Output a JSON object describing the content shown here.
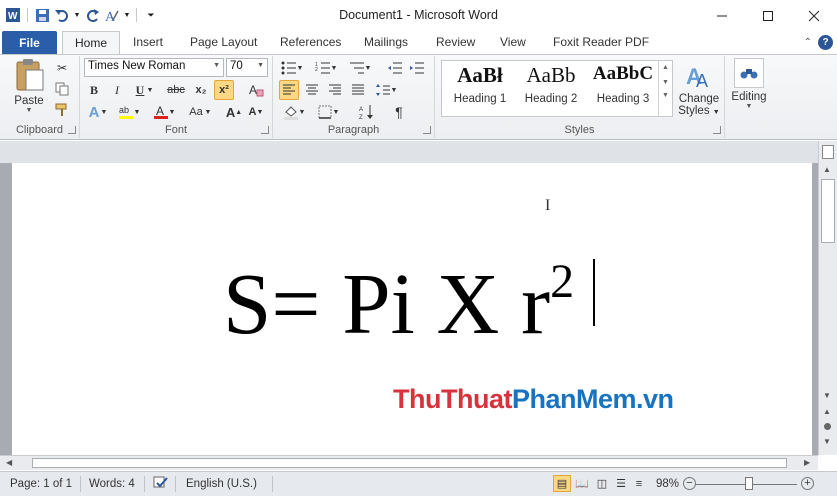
{
  "window": {
    "title": "Document1 - Microsoft Word",
    "app_icon": "word-icon",
    "controls": [
      "minimize-icon",
      "maximize-icon",
      "close-icon"
    ]
  },
  "quick_access": [
    "save-icon",
    "undo-icon",
    "redo-icon",
    "text-effects-icon",
    "customize-qat-icon"
  ],
  "tabs": {
    "file": "File",
    "items": [
      "Home",
      "Insert",
      "Page Layout",
      "References",
      "Mailings",
      "Review",
      "View",
      "Foxit Reader PDF"
    ],
    "active": "Home"
  },
  "ribbon": {
    "clipboard": {
      "label": "Clipboard",
      "paste": "Paste"
    },
    "font": {
      "label": "Font",
      "family": "Times New Roman",
      "size": "70"
    },
    "paragraph": {
      "label": "Paragraph"
    },
    "styles": {
      "label": "Styles",
      "items": [
        {
          "sample": "AaBł",
          "name": "Heading 1"
        },
        {
          "sample": "AaBb",
          "name": "Heading 2"
        },
        {
          "sample": "AaBbC",
          "name": "Heading 3"
        }
      ],
      "change_styles_1": "Change",
      "change_styles_2": "Styles"
    },
    "editing": {
      "label": "Editing"
    }
  },
  "document": {
    "formula_base": "S= Pi X r",
    "formula_sup": "2",
    "watermark_part1": "ThuThuat",
    "watermark_part2": "PhanMem.vn"
  },
  "status": {
    "page": "Page: 1 of 1",
    "words": "Words: 4",
    "language": "English (U.S.)",
    "zoom": "98%"
  },
  "colors": {
    "file_tab": "#2a5ea8",
    "highlight": "#fbd984",
    "watermark_red": "#d5343d",
    "watermark_blue": "#1873c1"
  }
}
